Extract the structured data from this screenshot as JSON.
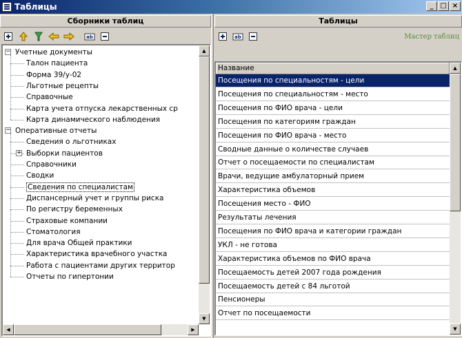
{
  "window": {
    "title": "Таблицы",
    "controls": [
      "_",
      "□",
      "×"
    ]
  },
  "left_pane": {
    "header": "Сборники таблиц",
    "toolbar": [
      "add-icon",
      "up-icon",
      "filter-icon",
      "back-icon",
      "forward-icon",
      "rename-icon",
      "remove-icon"
    ],
    "tree": [
      {
        "label": "Учетные документы",
        "level": 0,
        "expander": "−"
      },
      {
        "label": "Талон пациента",
        "level": 1
      },
      {
        "label": "Форма 39/у-02",
        "level": 1
      },
      {
        "label": "Льготные рецепты",
        "level": 1
      },
      {
        "label": "Справочные",
        "level": 1
      },
      {
        "label": "Карта учета отпуска лекарственных ср",
        "level": 1
      },
      {
        "label": "Карта динамического наблюдения",
        "level": 1
      },
      {
        "label": "Оперативные отчеты",
        "level": 0,
        "expander": "−"
      },
      {
        "label": "Сведения о льготниках",
        "level": 1
      },
      {
        "label": "Выборки пациентов",
        "level": 1,
        "expander": "+"
      },
      {
        "label": "Справочники",
        "level": 1
      },
      {
        "label": "Сводки",
        "level": 1
      },
      {
        "label": "Сведения по специалистам",
        "level": 1,
        "selected": true
      },
      {
        "label": "Диспансерный учет и группы риска",
        "level": 1
      },
      {
        "label": "По регистру беременных",
        "level": 1
      },
      {
        "label": "Страховые компании",
        "level": 1
      },
      {
        "label": "Стоматология",
        "level": 1
      },
      {
        "label": "Для врача Общей практики",
        "level": 1
      },
      {
        "label": "Характеристика врачебного участка",
        "level": 1
      },
      {
        "label": "Работа с пациентами других территор",
        "level": 1
      },
      {
        "label": "Отчеты по гипертонии",
        "level": 1
      }
    ]
  },
  "right_pane": {
    "header": "Таблицы",
    "toolbar": [
      "add-icon",
      "rename-icon",
      "remove-icon"
    ],
    "status_label": "Мастер таблиц",
    "column_header": "Название",
    "rows": [
      {
        "label": "Посещения по специальностям - цели",
        "selected": true
      },
      {
        "label": "Посещения по специальностям - место"
      },
      {
        "label": "Посещения по ФИО врача - цели"
      },
      {
        "label": "Посещения по категориям граждан"
      },
      {
        "label": "Посещения по ФИО врача - место"
      },
      {
        "label": "Сводные данные о количестве случаев"
      },
      {
        "label": "Отчет о посещаемости по специалистам"
      },
      {
        "label": "Врачи, ведущие амбулаторный прием"
      },
      {
        "label": "Характеристика объемов"
      },
      {
        "label": "Посещения место - ФИО"
      },
      {
        "label": "Результаты лечения"
      },
      {
        "label": "Посещения по ФИО врача и категории граждан"
      },
      {
        "label": "УКЛ - не готова"
      },
      {
        "label": "Характеристика объемов по ФИО врача"
      },
      {
        "label": "Посещаемость детей 2007 года рождения"
      },
      {
        "label": "Посещаемость детей с 84 льготой"
      },
      {
        "label": "Пенсионеры"
      },
      {
        "label": "Отчет по посещаемости"
      }
    ]
  }
}
